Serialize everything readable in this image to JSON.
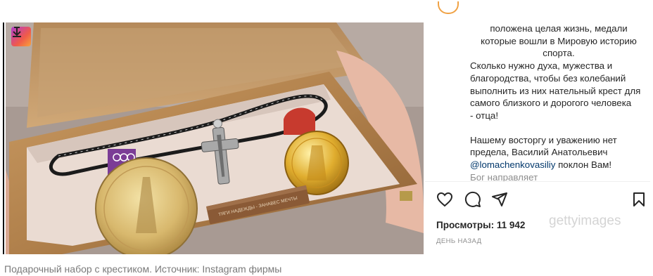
{
  "post": {
    "caption_lines": [
      "положена целая жизнь, медали",
      "которые вошли в Мировую историю",
      "спорта.",
      "Сколько нужно духа, мужества и",
      "благородства, чтобы без колебаний",
      "выполнить из них нательный крест для",
      "самого близкого и дорогого человека",
      "- отца!",
      "Нашему восторгу и уважению нет",
      "предела, Василий Анатольевич",
      "@lomachenkovasiliy поклон Вам!",
      "Бог направляет"
    ],
    "mention": "@lomachenkovasiliy",
    "views": "Просмотры: 11 942",
    "timestamp": "ДЕНЬ НАЗАД",
    "watermark": "gettyimages",
    "plaque_text": "ТЯГИ НАДЕЖДЫ - ЗАНАВЕС МЕЧТЫ"
  },
  "actions": {
    "like_icon": "heart-icon",
    "comment_icon": "comment-icon",
    "share_icon": "send-icon",
    "save_icon": "bookmark-icon"
  },
  "photo_caption": "Подарочный набор с крестиком. Источник: Instagram фирмы",
  "colors": {
    "caption_text": "#262626",
    "mention": "#00376b",
    "muted": "#8e8e8e",
    "photo_caption": "#7a7a7a",
    "wood_box": "#b98a55",
    "gold": "#d8b35a",
    "ribbon_purple": "#7b3c96",
    "ribbon_red": "#c73a2e"
  }
}
